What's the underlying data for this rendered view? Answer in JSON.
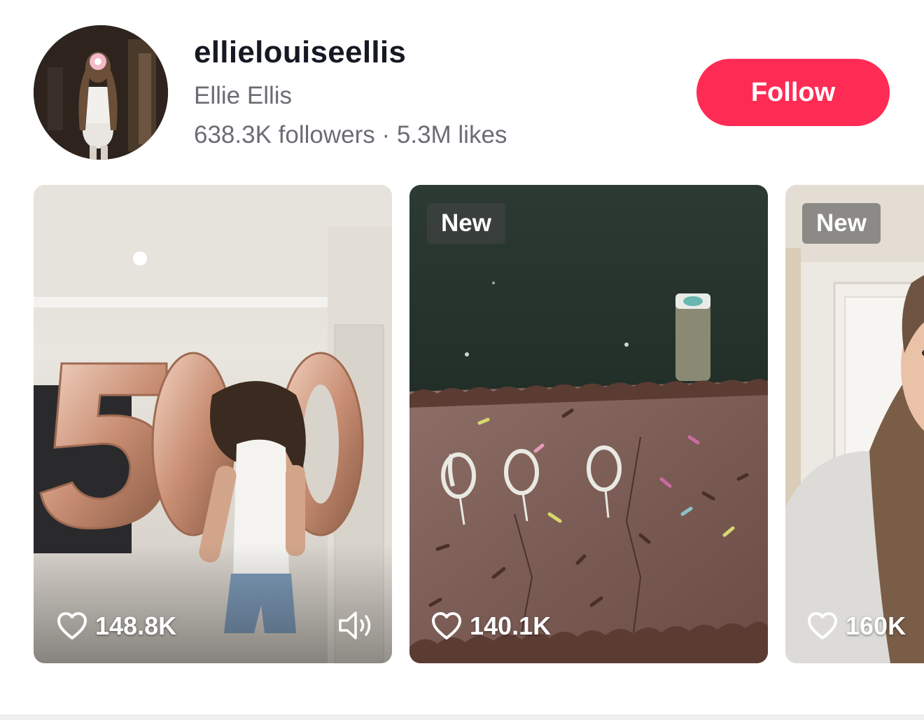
{
  "profile": {
    "username": "ellielouiseellis",
    "display_name": "Ellie Ellis",
    "followers": "638.3K followers",
    "separator": " · ",
    "likes": "5.3M likes",
    "avatar_icon": "avatar-photo"
  },
  "follow_button": {
    "label": "Follow",
    "color": "#fe2c55"
  },
  "videos": [
    {
      "badge": "",
      "likes": "148.8K",
      "sound_icon": "speaker-icon"
    },
    {
      "badge": "New",
      "likes": "140.1K"
    },
    {
      "badge": "New",
      "likes": "160K"
    }
  ]
}
